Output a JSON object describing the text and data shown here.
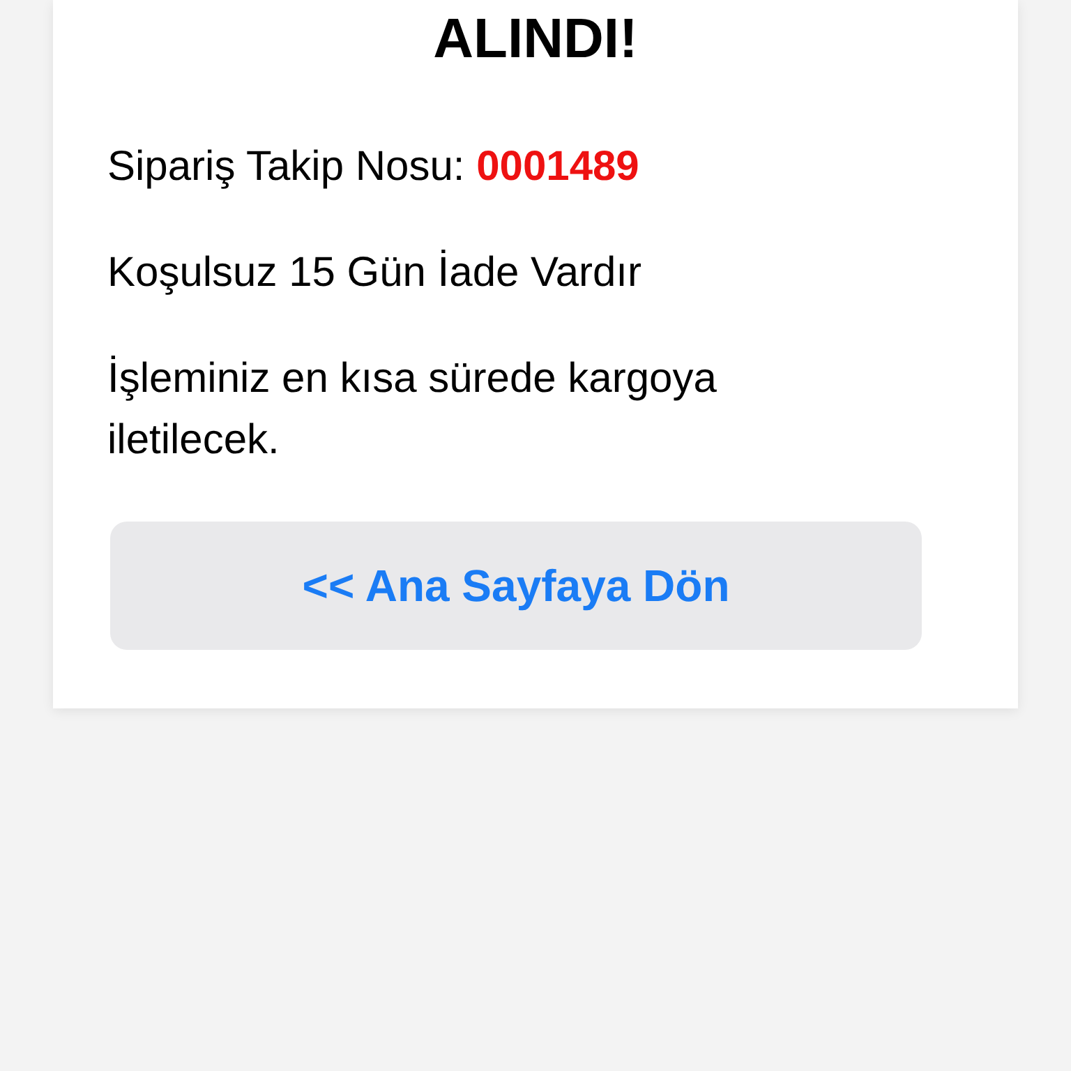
{
  "heading": "ALINDI!",
  "tracking": {
    "label": "Sipariş Takip Nosu:",
    "number": "0001489"
  },
  "notes": [
    "Koşulsuz 15 Gün İade Vardır",
    "İşleminiz en kısa sürede kargoya iletilecek."
  ],
  "button": {
    "label": "<< Ana Sayfaya Dön"
  }
}
